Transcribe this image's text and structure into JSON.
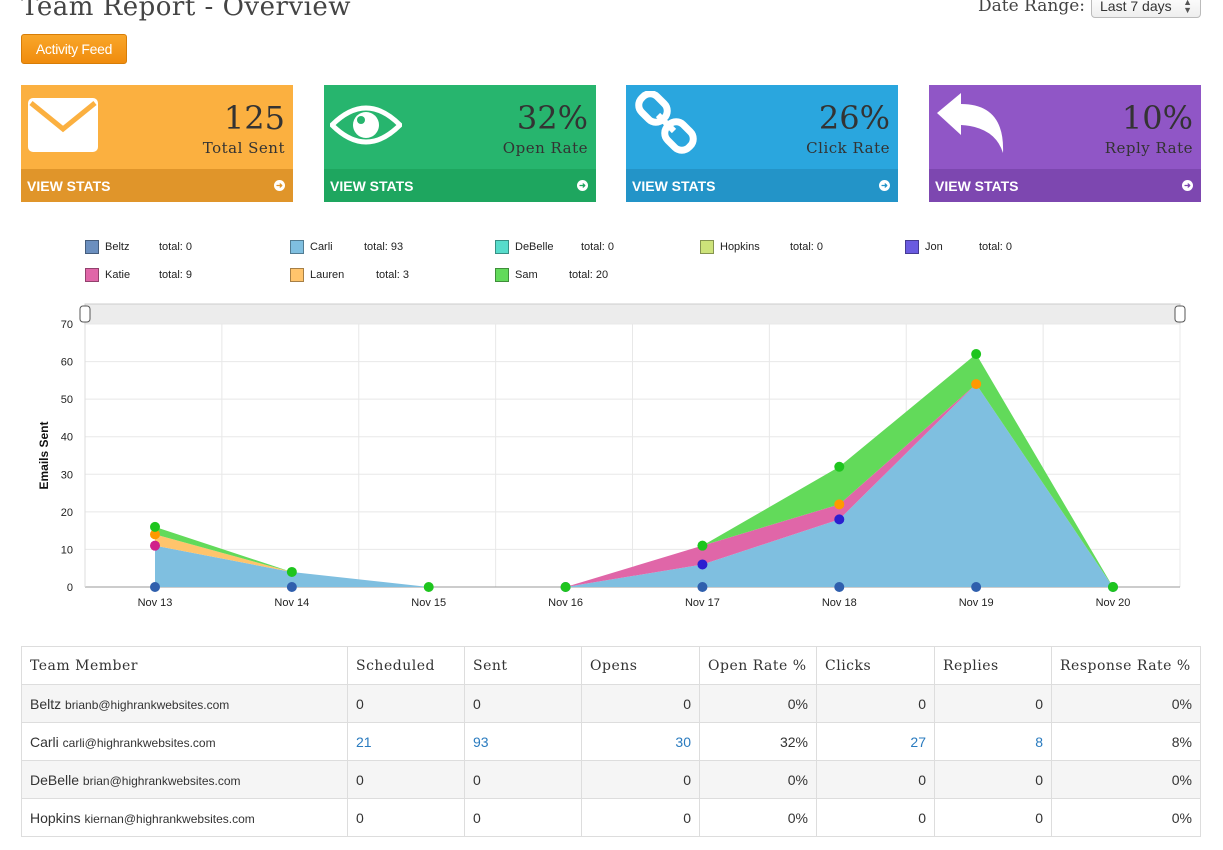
{
  "header": {
    "title": "Team Report - Overview",
    "date_range_label": "Date Range:",
    "date_range_value": "Last 7 days"
  },
  "activity_feed_label": "Activity Feed",
  "cards": [
    {
      "value": "125",
      "label": "Total Sent",
      "link": "VIEW STATS",
      "icon": "envelope-icon",
      "color": "#fbb040",
      "dark": "#e0952a"
    },
    {
      "value": "32%",
      "label": "Open Rate",
      "link": "VIEW STATS",
      "icon": "eye-icon",
      "color": "#27b56e",
      "dark": "#1ea65f"
    },
    {
      "value": "26%",
      "label": "Click Rate",
      "link": "VIEW STATS",
      "icon": "link-icon",
      "color": "#2aa6de",
      "dark": "#2394c8"
    },
    {
      "value": "10%",
      "label": "Reply Rate",
      "link": "VIEW STATS",
      "icon": "reply-icon",
      "color": "#9056c6",
      "dark": "#7d47b0"
    }
  ],
  "legend": [
    {
      "name": "Beltz",
      "total": "total: 0",
      "color": "#6b8fbf"
    },
    {
      "name": "Carli",
      "total": "total: 93",
      "color": "#7fbfe0"
    },
    {
      "name": "DeBelle",
      "total": "total: 0",
      "color": "#57dccb"
    },
    {
      "name": "Hopkins",
      "total": "total: 0",
      "color": "#cde37a"
    },
    {
      "name": "Jon",
      "total": "total: 0",
      "color": "#6a5be0"
    },
    {
      "name": "Katie",
      "total": "total: 9",
      "color": "#e066a8"
    },
    {
      "name": "Lauren",
      "total": "total: 3",
      "color": "#ffc46c"
    },
    {
      "name": "Sam",
      "total": "total: 20",
      "color": "#62da5a"
    }
  ],
  "chart_data": {
    "type": "area",
    "ylabel": "Emails Sent",
    "ylim": [
      0,
      70
    ],
    "yticks": [
      0,
      10,
      20,
      30,
      40,
      50,
      60,
      70
    ],
    "categories": [
      "Nov 13",
      "Nov 14",
      "Nov 15",
      "Nov 16",
      "Nov 17",
      "Nov 18",
      "Nov 19",
      "Nov 20"
    ],
    "stacked": true,
    "series": [
      {
        "name": "Beltz",
        "values": [
          0,
          0,
          null,
          0,
          0,
          0,
          0,
          0
        ],
        "color": "#2f5fad"
      },
      {
        "name": "Carli",
        "values": [
          11,
          4,
          0,
          0,
          6,
          18,
          54,
          0
        ],
        "color": "#7fbfe0"
      },
      {
        "name": "Jon",
        "values": [
          11,
          4,
          0,
          0,
          6,
          18,
          54,
          0
        ],
        "color": "#2a1fd0"
      },
      {
        "name": "Katie",
        "values": [
          0,
          0,
          0,
          0,
          5,
          4,
          0,
          0
        ],
        "color": "#e066a8"
      },
      {
        "name": "Lauren",
        "values": [
          3,
          0,
          0,
          0,
          0,
          0,
          0,
          0
        ],
        "color": "#ffc46c"
      },
      {
        "name": "Sam",
        "values": [
          2,
          0,
          0,
          0,
          0,
          10,
          8,
          0
        ],
        "color": "#62da5a"
      }
    ],
    "markers": [
      {
        "series": "Beltz",
        "points": [
          [
            0,
            0
          ],
          [
            1,
            0
          ],
          [
            3,
            0
          ],
          [
            4,
            0
          ],
          [
            5,
            0
          ],
          [
            6,
            0
          ],
          [
            7,
            0
          ]
        ],
        "color": "#2f5fad"
      },
      {
        "series": "Jon",
        "points": [
          [
            4,
            6
          ],
          [
            5,
            18
          ]
        ],
        "color": "#2a1fd0"
      },
      {
        "series": "Katie",
        "points": [
          [
            0,
            11
          ]
        ],
        "color": "#d0208a"
      },
      {
        "series": "Lauren",
        "points": [
          [
            0,
            14
          ],
          [
            5,
            22
          ],
          [
            6,
            54
          ]
        ],
        "color": "#ff9900"
      },
      {
        "series": "Sam",
        "points": [
          [
            0,
            16
          ],
          [
            1,
            4
          ],
          [
            2,
            0
          ],
          [
            3,
            0
          ],
          [
            4,
            11
          ],
          [
            5,
            32
          ],
          [
            6,
            62
          ],
          [
            7,
            0
          ]
        ],
        "color": "#1ec51e"
      }
    ]
  },
  "table": {
    "headers": [
      "Team Member",
      "Scheduled",
      "Sent",
      "Opens",
      "Open Rate %",
      "Clicks",
      "Replies",
      "Response Rate %"
    ],
    "rows": [
      {
        "name": "Beltz",
        "email": "brianb@highrankwebsites.com",
        "scheduled": "0",
        "sent": "0",
        "opens": "0",
        "open_rate": "0%",
        "clicks": "0",
        "replies": "0",
        "response_rate": "0%"
      },
      {
        "name": "Carli",
        "email": "carli@highrankwebsites.com",
        "scheduled": "21",
        "sent": "93",
        "opens": "30",
        "open_rate": "32%",
        "clicks": "27",
        "replies": "8",
        "response_rate": "8%"
      },
      {
        "name": "DeBelle",
        "email": "brian@highrankwebsites.com",
        "scheduled": "0",
        "sent": "0",
        "opens": "0",
        "open_rate": "0%",
        "clicks": "0",
        "replies": "0",
        "response_rate": "0%"
      },
      {
        "name": "Hopkins",
        "email": "kiernan@highrankwebsites.com",
        "scheduled": "0",
        "sent": "0",
        "opens": "0",
        "open_rate": "0%",
        "clicks": "0",
        "replies": "0",
        "response_rate": "0%"
      }
    ]
  }
}
